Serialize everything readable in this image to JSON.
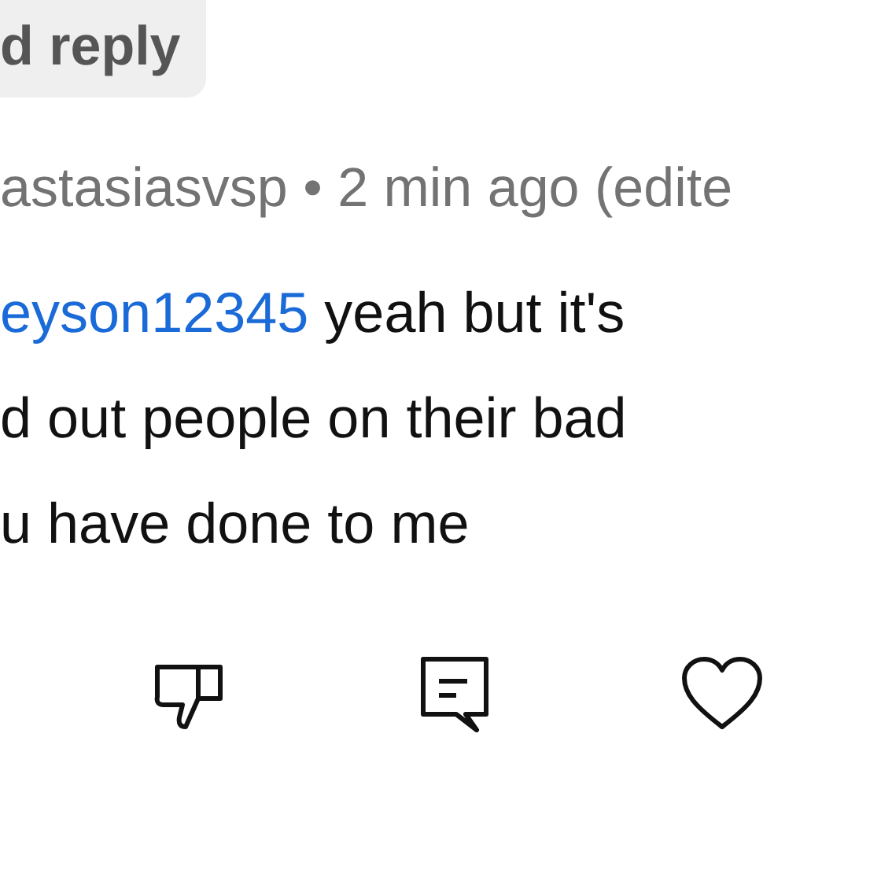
{
  "reply_button": {
    "label": "d reply"
  },
  "comment": {
    "meta": "astasiasvsp • 2 min ago (edite",
    "lines": [
      {
        "mention": "eyson12345",
        "text": " yeah but it's"
      },
      {
        "text": "d out people on their bad"
      },
      {
        "text": "u have done to me"
      }
    ]
  }
}
